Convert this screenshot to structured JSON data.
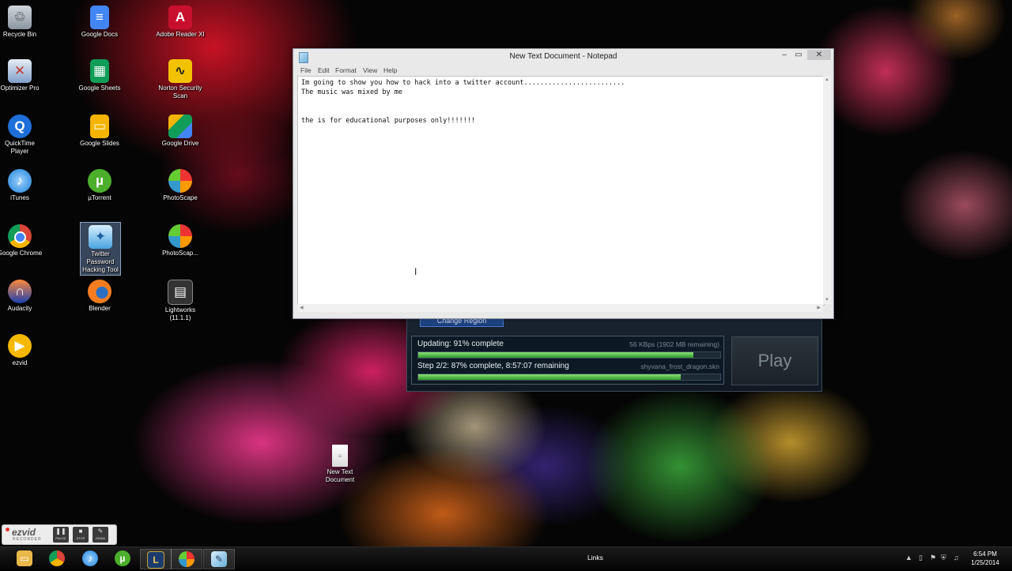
{
  "desktop": {
    "icons": {
      "recycle_bin": "Recycle Bin",
      "optimizer_pro": "Optimizer Pro",
      "quicktime": "QuickTime Player",
      "itunes": "iTunes",
      "google_chrome": "Google Chrome",
      "audacity": "Audacity",
      "ezvid": "ezvid",
      "google_docs": "Google Docs",
      "google_sheets": "Google Sheets",
      "google_slides": "Google Slides",
      "utorrent": "µTorrent",
      "twitter_tool": "Twitter Password Hacking Tool",
      "blender": "Blender",
      "adobe_reader": "Adobe Reader XI",
      "norton": "Norton Security Scan",
      "google_drive": "Google Drive",
      "photoscape": "PhotoScape",
      "photoscape2": "PhotoScap...",
      "lightworks": "Lightworks (11.1.1)",
      "new_text_doc": "New Text Document"
    }
  },
  "launcher": {
    "region_button": "Change Region",
    "update_label": "Updating: 91% complete",
    "update_detail": "56 KBps (1902 MB remaining)",
    "update_progress": 0.91,
    "step_label": "Step 2/2: 87% complete, 8:57:07 remaining",
    "step_detail": "shyvana_frost_dragon.skn",
    "step_progress": 0.87,
    "play_button": "Play"
  },
  "notepad": {
    "title": "New Text Document - Notepad",
    "menu": {
      "file": "File",
      "edit": "Edit",
      "format": "Format",
      "view": "View",
      "help": "Help"
    },
    "lines": {
      "l1": "Im going to show you how to hack into a twitter account.........................",
      "l2": "The music was mixed by me",
      "l3": "the is for educational purposes only!!!!!!!"
    }
  },
  "recorder": {
    "logo": "ezvid",
    "subtitle": "RECORDER",
    "pause": "PAUSE",
    "stop": "STOP",
    "draw": "DRAW"
  },
  "taskbar": {
    "links": "Links",
    "time": "6:54 PM",
    "date": "1/25/2014"
  },
  "colors": {
    "progress_green": "#3fae36",
    "play_text": "#7f8a92",
    "region_blue": "#2d5aa8"
  }
}
